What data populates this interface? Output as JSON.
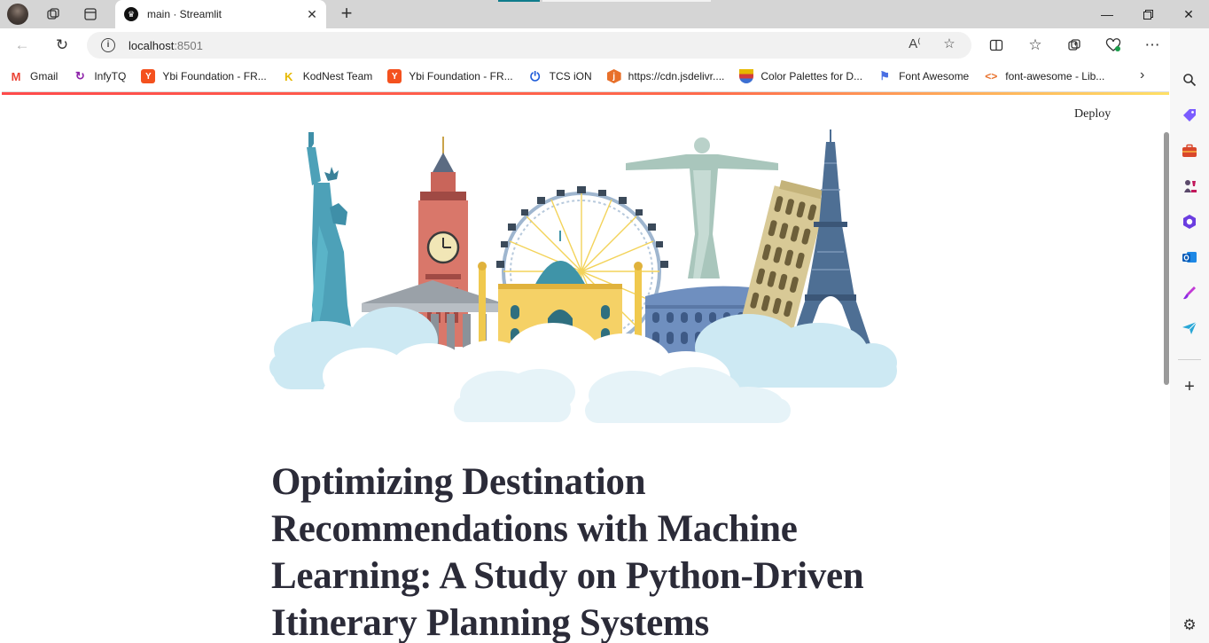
{
  "browser": {
    "tab_title": "main · Streamlit",
    "url_host": "localhost",
    "url_port": ":8501",
    "bookmarks": [
      {
        "label": "Gmail",
        "icon": "gmail-icon",
        "color": "#ea4335"
      },
      {
        "label": "InfyTQ",
        "icon": "infytq-icon",
        "color": "#8e24aa"
      },
      {
        "label": "Ybi Foundation - FR...",
        "icon": "ybi-icon",
        "color": "#f4511e"
      },
      {
        "label": "KodNest Team",
        "icon": "kodnest-icon",
        "color": "#f5c400"
      },
      {
        "label": "Ybi Foundation - FR...",
        "icon": "ybi-icon",
        "color": "#f4511e"
      },
      {
        "label": "TCS iON",
        "icon": "power-icon",
        "color": "#1e5bd8"
      },
      {
        "label": "https://cdn.jsdelivr....",
        "icon": "jsdelivr-icon",
        "color": "#e84d3d"
      },
      {
        "label": "Color Palettes for D...",
        "icon": "palette-icon",
        "color": "#e6b800"
      },
      {
        "label": "Font Awesome",
        "icon": "flag-icon",
        "color": "#4a6fe3"
      },
      {
        "label": "font-awesome - Lib...",
        "icon": "code-icon",
        "color": "#e8702a"
      }
    ]
  },
  "app": {
    "deploy_label": "Deploy",
    "title": "Optimizing Destination Recommendations with Machine Learning: A Study on Python-Driven Itinerary Planning Systems",
    "hero_image": "world-landmarks-illustration"
  },
  "colors": {
    "streamlit_accent": "#ff4b4b",
    "title_color": "#2b2b38"
  }
}
